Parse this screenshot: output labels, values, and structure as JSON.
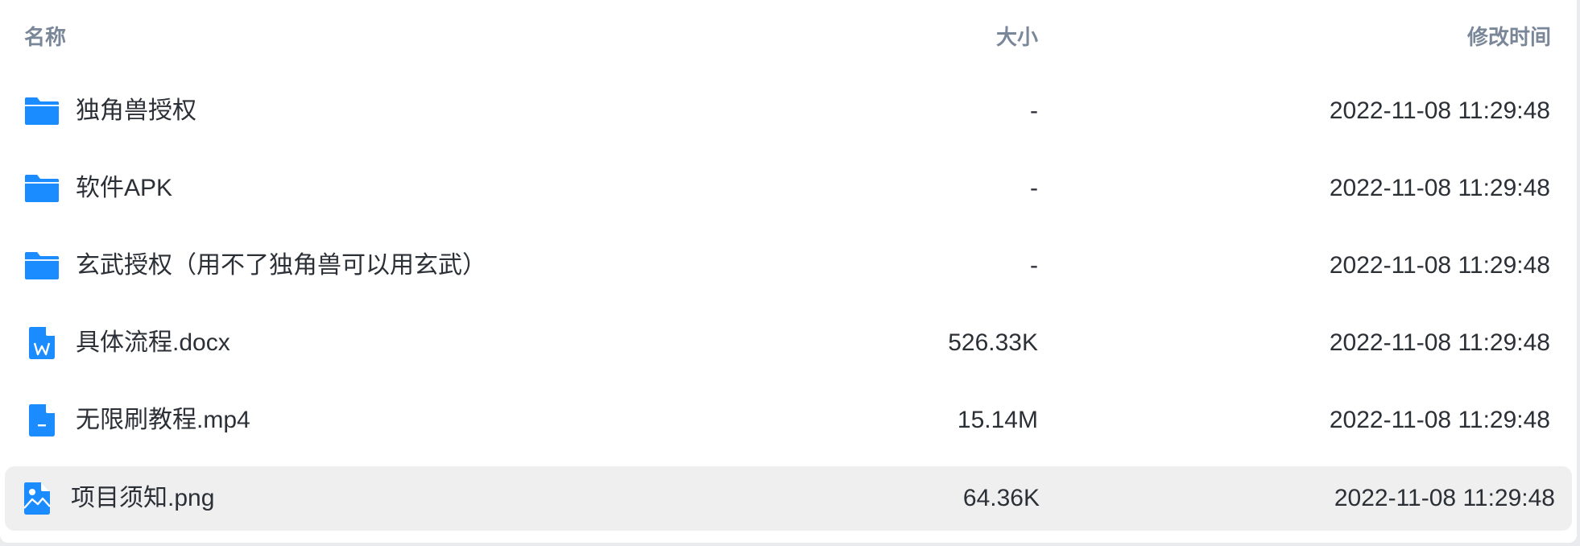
{
  "header": {
    "name": "名称",
    "size": "大小",
    "modified": "修改时间"
  },
  "colors": {
    "icon_blue": "#1a8cff",
    "header_text": "#7a8799",
    "row_text": "#2b2f36",
    "selected_row": "#efefef"
  },
  "files": [
    {
      "icon": "folder-icon",
      "name": "独角兽授权",
      "size": "-",
      "modified": "2022-11-08 11:29:48"
    },
    {
      "icon": "folder-icon",
      "name": "软件APK",
      "size": "-",
      "modified": "2022-11-08 11:29:48"
    },
    {
      "icon": "folder-icon",
      "name": "玄武授权（用不了独角兽可以用玄武）",
      "size": "-",
      "modified": "2022-11-08 11:29:48"
    },
    {
      "icon": "word-document-icon",
      "name": "具体流程.docx",
      "size": "526.33K",
      "modified": "2022-11-08 11:29:48"
    },
    {
      "icon": "video-file-icon",
      "name": "无限刷教程.mp4",
      "size": "15.14M",
      "modified": "2022-11-08 11:29:48"
    },
    {
      "icon": "image-file-icon",
      "name": "项目须知.png",
      "size": "64.36K",
      "modified": "2022-11-08 11:29:48",
      "selected": true
    }
  ]
}
